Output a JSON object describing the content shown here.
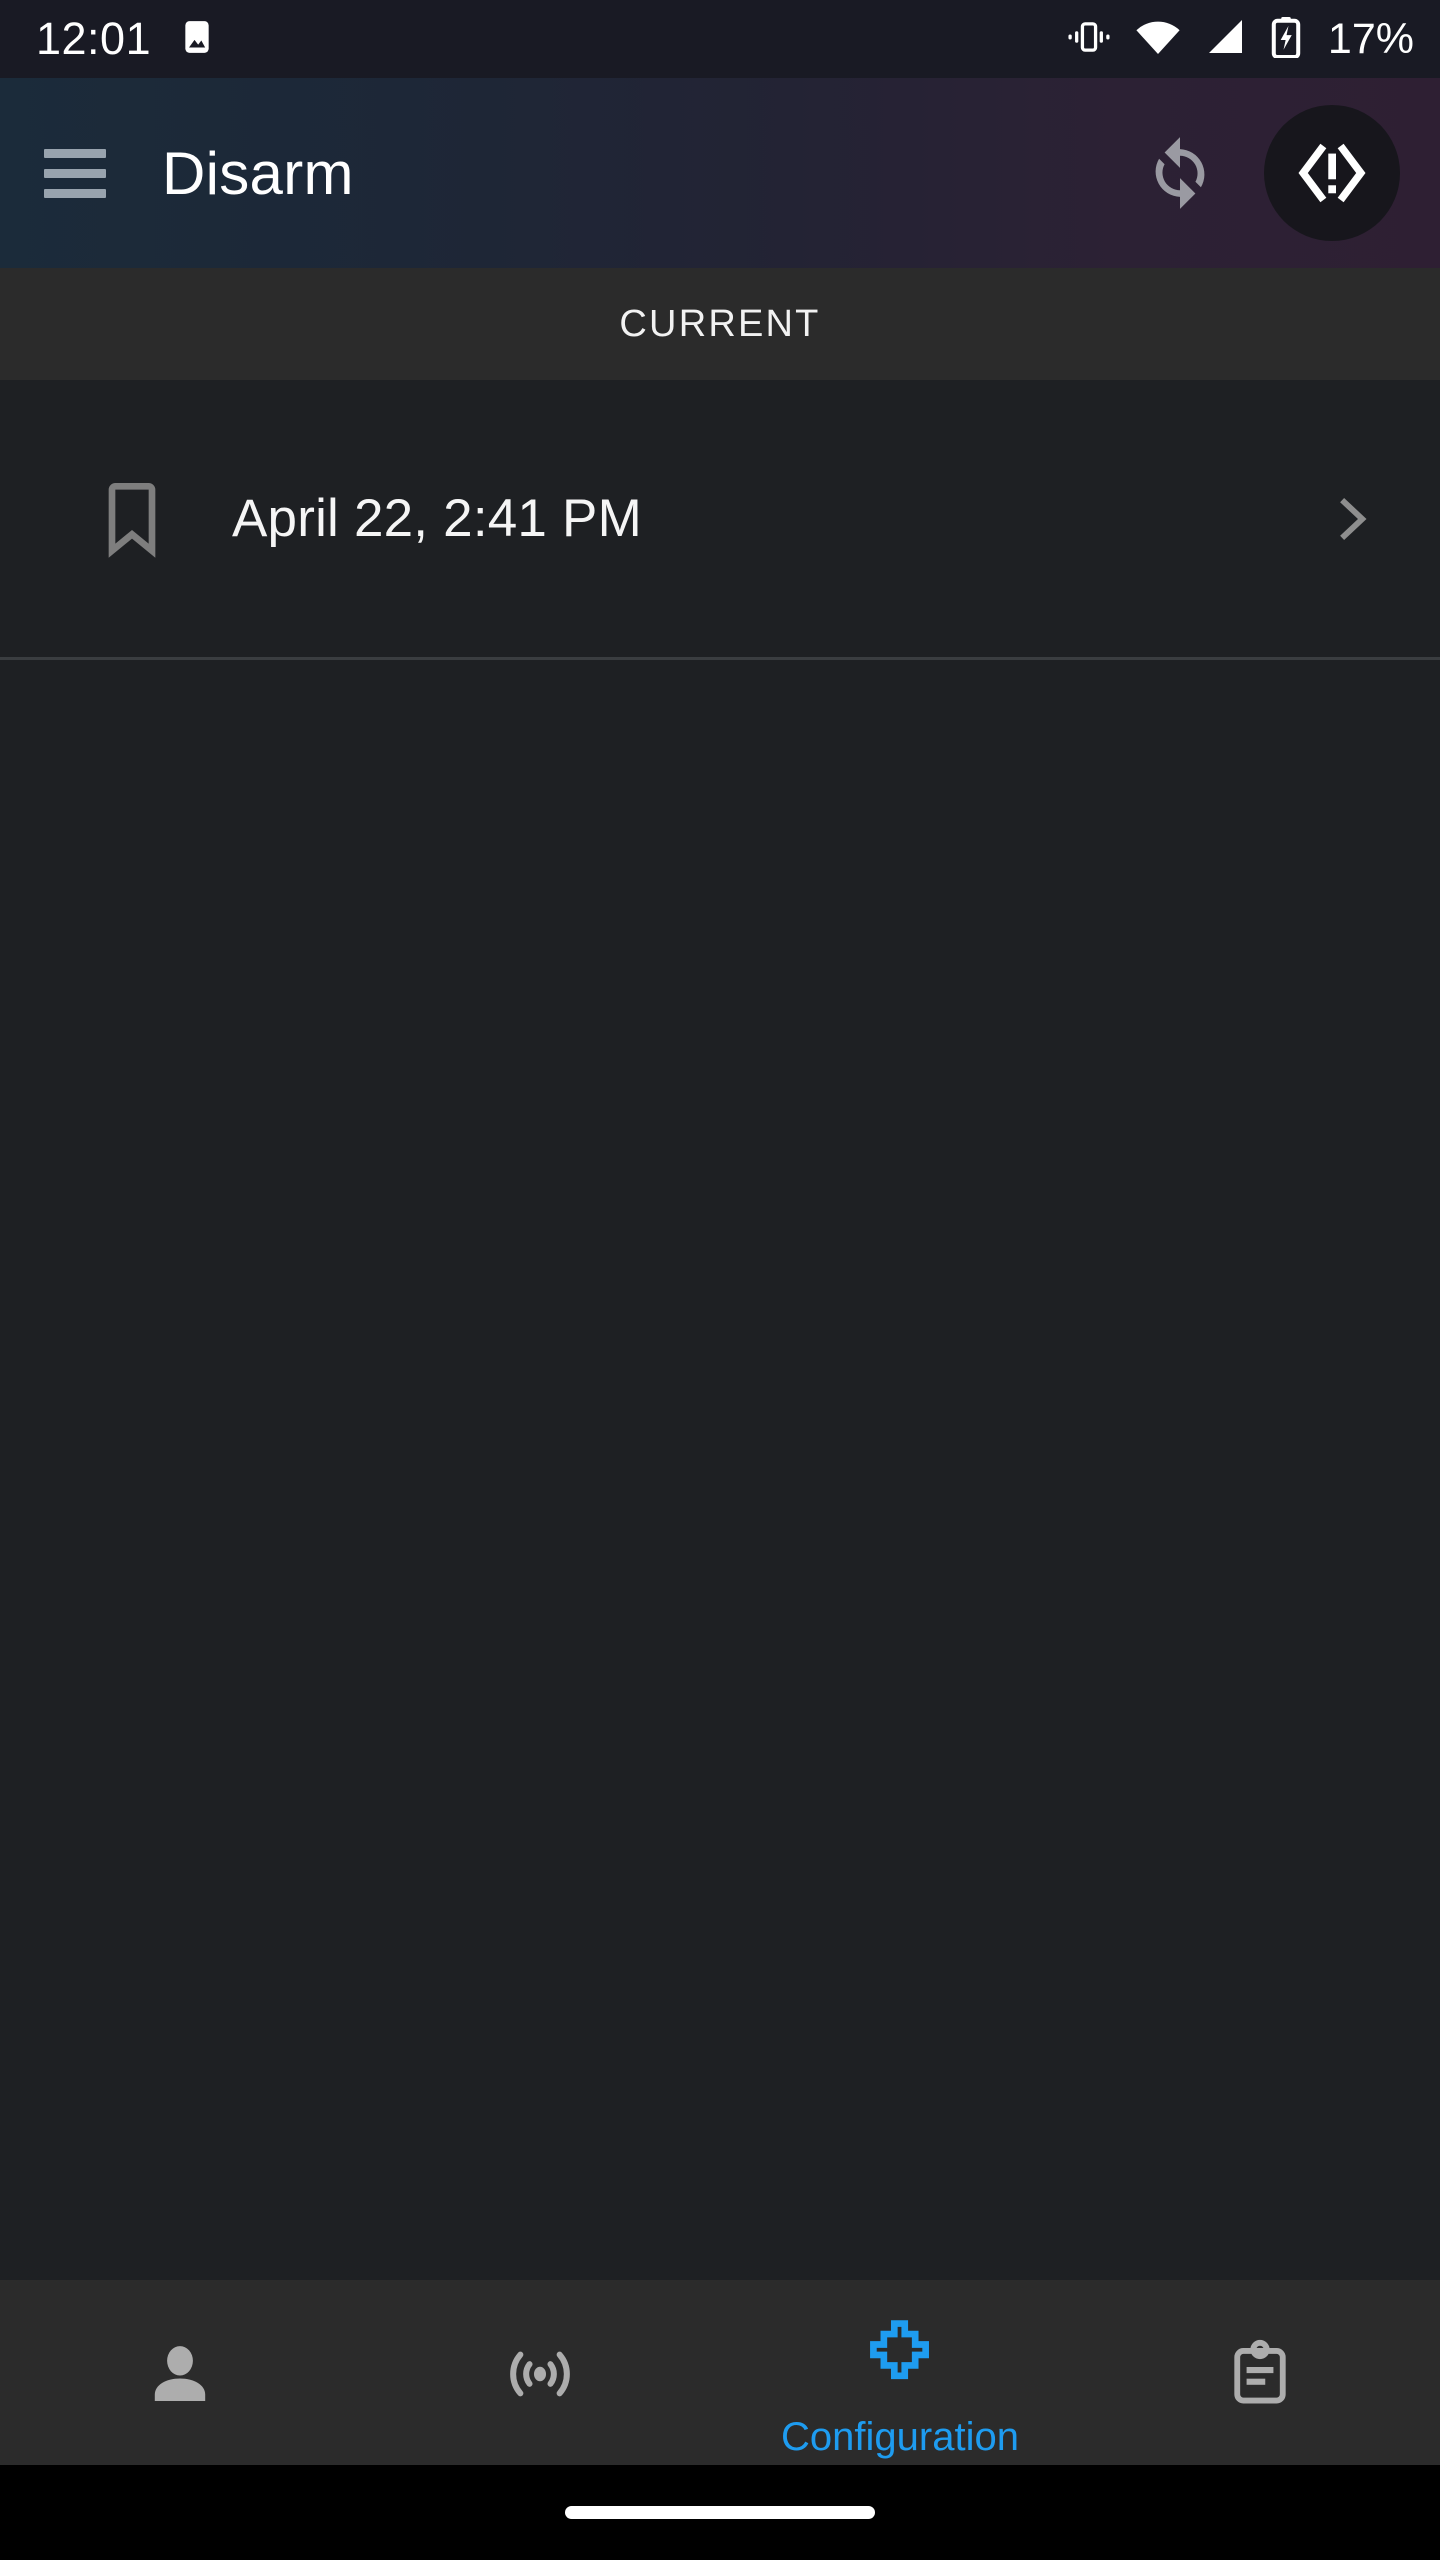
{
  "statusbar": {
    "time": "12:01",
    "battery_percent": "17%",
    "icons": {
      "photo": "image-icon",
      "vibrate": "vibrate-icon",
      "wifi": "wifi-icon",
      "cellular": "cellular-signal-icon",
      "battery": "battery-charging-icon"
    },
    "background_color": "#191a24"
  },
  "appbar": {
    "title": "Disarm",
    "menu_icon": "hamburger-menu-icon",
    "sync_icon": "sync-refresh-icon",
    "alert_icon": "code-alert-icon",
    "alert_glyph": "<!>",
    "gradient_start": "#1b2b3a",
    "gradient_end": "#2e1f33"
  },
  "tabs": [
    {
      "label": "CURRENT",
      "active": true
    }
  ],
  "list": {
    "rows": [
      {
        "icon": "bookmark-icon",
        "text": "April 22, 2:41 PM",
        "chevron": "chevron-right-icon"
      }
    ]
  },
  "bottomnav": {
    "active_color": "#1e9cf0",
    "inactive_color": "#adadad",
    "items": [
      {
        "icon": "person-icon",
        "label": "",
        "active": false
      },
      {
        "icon": "sensor-motion-icon",
        "label": "",
        "active": false
      },
      {
        "icon": "configuration-grid-icon",
        "label": "Configuration",
        "active": true
      },
      {
        "icon": "clipboard-log-icon",
        "label": "",
        "active": false
      }
    ]
  },
  "gesturebar": {
    "pill": "home-gesture-pill"
  }
}
